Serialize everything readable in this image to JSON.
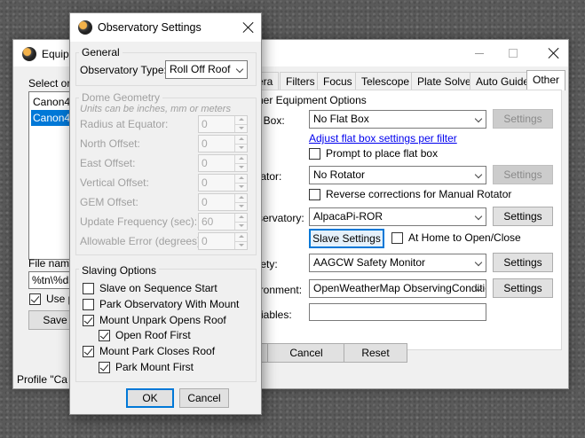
{
  "equipment_window": {
    "title": "Equip",
    "list_label": "Select or",
    "list_items": [
      "Canon40",
      "Canon40"
    ],
    "file_naming_label": "File namin",
    "file_naming_value": "%tn\\%ds",
    "use_label": "Use p",
    "save_label": "Save",
    "profile_label": "Profile \"Ca",
    "tabs": [
      "era",
      "Filters",
      "Focus",
      "Telescope",
      "Plate Solve",
      "Auto Guide",
      "Other"
    ],
    "active_tab": "Other",
    "section_title": "her Equipment Options",
    "flat_box": {
      "label": "t Box:",
      "value": "No Flat Box",
      "settings": "Settings"
    },
    "flat_box_link": "Adjust flat box settings per filter",
    "prompt_flat": "Prompt to place flat box",
    "rotator": {
      "label": "tator:",
      "value": "No Rotator",
      "settings": "Settings"
    },
    "reverse_rot": "Reverse corrections for Manual Rotator",
    "observatory": {
      "label": "servatory:",
      "value": "AlpacaPi-ROR",
      "settings": "Settings"
    },
    "slave_settings": "Slave Settings",
    "at_home": "At Home to Open/Close",
    "safety": {
      "label": "fety:",
      "value": "AAGCW Safety Monitor",
      "settings": "Settings"
    },
    "environment": {
      "label": "ironment:",
      "value": "OpenWeatherMap ObservingConditic",
      "settings": "Settings"
    },
    "variables_label": "riables:",
    "cancel": "Cancel",
    "reset": "Reset"
  },
  "dialog": {
    "title": "Observatory Settings",
    "general": "General",
    "obs_type_label": "Observatory Type:",
    "obs_type_value": "Roll Off Roof",
    "dome_geometry": "Dome Geometry",
    "units_note": "Units can be inches, mm or meters",
    "fields": [
      {
        "label": "Radius at Equator:",
        "value": "0"
      },
      {
        "label": "North Offset:",
        "value": "0"
      },
      {
        "label": "East Offset:",
        "value": "0"
      },
      {
        "label": "Vertical Offset:",
        "value": "0"
      },
      {
        "label": "GEM Offset:",
        "value": "0"
      },
      {
        "label": "Update Frequency (sec):",
        "value": "60"
      },
      {
        "label": "Allowable Error (degrees):",
        "value": "0"
      }
    ],
    "slaving_options": "Slaving Options",
    "options": [
      {
        "label": "Slave on Sequence Start",
        "checked": false
      },
      {
        "label": "Park Observatory With Mount",
        "checked": false
      },
      {
        "label": "Mount Unpark Opens Roof",
        "checked": true
      },
      {
        "label": "Open Roof First",
        "checked": true
      },
      {
        "label": "Mount Park Closes Roof",
        "checked": true
      },
      {
        "label": "Park Mount First",
        "checked": true
      }
    ],
    "ok": "OK",
    "cancel": "Cancel"
  }
}
